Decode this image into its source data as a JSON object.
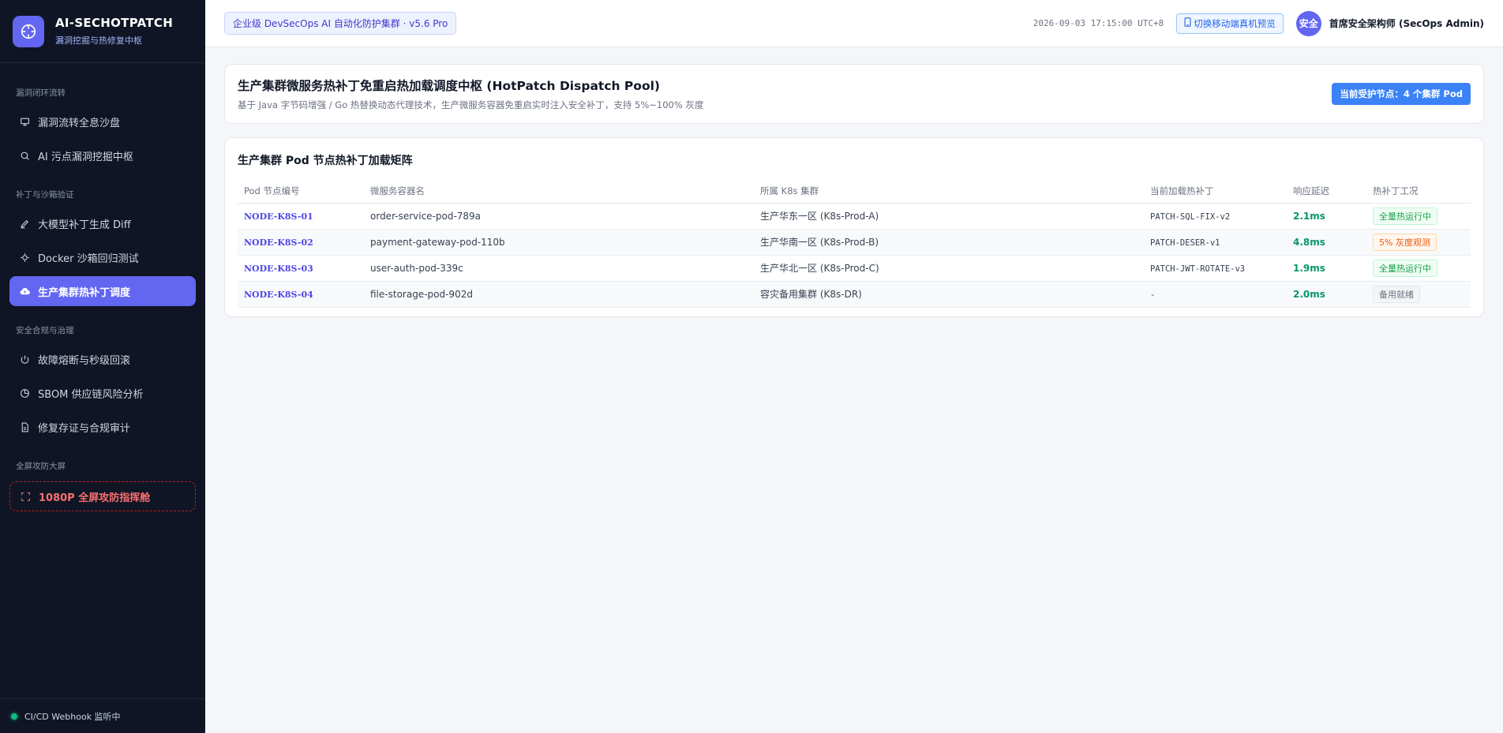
{
  "brand": {
    "title": "AI-SECHOTPATCH",
    "subtitle": "漏洞挖掘与热修复中枢",
    "logo_icon": "crosshair-icon"
  },
  "sidebar": {
    "groups": [
      {
        "label": "漏洞闭环流转",
        "items": [
          {
            "label": "漏洞流转全息沙盘",
            "icon": "monitor-icon"
          },
          {
            "label": "AI 污点漏洞挖掘中枢",
            "icon": "search-icon"
          }
        ]
      },
      {
        "label": "补丁与沙箱验证",
        "items": [
          {
            "label": "大模型补丁生成 Diff",
            "icon": "pencil-icon"
          },
          {
            "label": "Docker 沙箱回归测试",
            "icon": "cpu-icon"
          },
          {
            "label": "生产集群热补丁调度",
            "icon": "cloud-upload-icon",
            "active": true
          }
        ]
      },
      {
        "label": "安全合规与治理",
        "items": [
          {
            "label": "故障熔断与秒级回滚",
            "icon": "power-icon"
          },
          {
            "label": "SBOM 供应链风险分析",
            "icon": "pie-chart-icon"
          },
          {
            "label": "修复存证与合规审计",
            "icon": "file-icon"
          }
        ]
      },
      {
        "label": "全屏攻防大屏",
        "items": [
          {
            "label": "1080P 全屏攻防指挥舱",
            "icon": "fullscreen-icon",
            "danger": true
          }
        ]
      }
    ],
    "footer": {
      "status": "CI/CD Webhook 监听中",
      "status_color": "#10b981"
    }
  },
  "header": {
    "env_badge": "企业级 DevSecOps AI 自动化防护集群 · v5.6 Pro",
    "datetime": "2026-09-03 17:15:00 UTC+8",
    "mobile_button": "切换移动端真机预览",
    "mobile_icon": "mobile-icon",
    "avatar_text": "安全",
    "user_name": "首席安全架构师 (SecOps Admin)"
  },
  "hero": {
    "title": "生产集群微服务热补丁免重启热加载调度中枢 (HotPatch Dispatch Pool)",
    "description": "基于 Java 字节码增强 / Go 热替换动态代理技术，生产微服务容器免重启实时注入安全补丁，支持 5%~100% 灰度",
    "node_badge": "当前受护节点：4 个集群 Pod"
  },
  "matrix": {
    "title": "生产集群 Pod 节点热补丁加载矩阵",
    "columns": [
      "Pod 节点编号",
      "微服务容器名",
      "所属 K8s 集群",
      "当前加载热补丁",
      "响应延迟",
      "热补丁工况"
    ],
    "rows": [
      {
        "node": "NODE-K8S-01",
        "container": "order-service-pod-789a",
        "cluster": "生产华东一区 (K8s-Prod-A)",
        "patch": "PATCH-SQL-FIX-v2",
        "latency": "2.1ms",
        "status": "全量热运行中",
        "status_type": "green"
      },
      {
        "node": "NODE-K8S-02",
        "container": "payment-gateway-pod-110b",
        "cluster": "生产华南一区 (K8s-Prod-B)",
        "patch": "PATCH-DESER-v1",
        "latency": "4.8ms",
        "status": "5% 灰度观测",
        "status_type": "orange"
      },
      {
        "node": "NODE-K8S-03",
        "container": "user-auth-pod-339c",
        "cluster": "生产华北一区 (K8s-Prod-C)",
        "patch": "PATCH-JWT-ROTATE-v3",
        "latency": "1.9ms",
        "status": "全量热运行中",
        "status_type": "green"
      },
      {
        "node": "NODE-K8S-04",
        "container": "file-storage-pod-902d",
        "cluster": "容灾备用集群 (K8s-DR)",
        "patch": "-",
        "latency": "2.0ms",
        "status": "备用就绪",
        "status_type": "gray"
      }
    ]
  },
  "colors": {
    "accent": "#6366f1",
    "sidebar_bg": "#0f1524",
    "success": "#059669",
    "warning": "#ea580c",
    "info": "#3b82f6"
  }
}
